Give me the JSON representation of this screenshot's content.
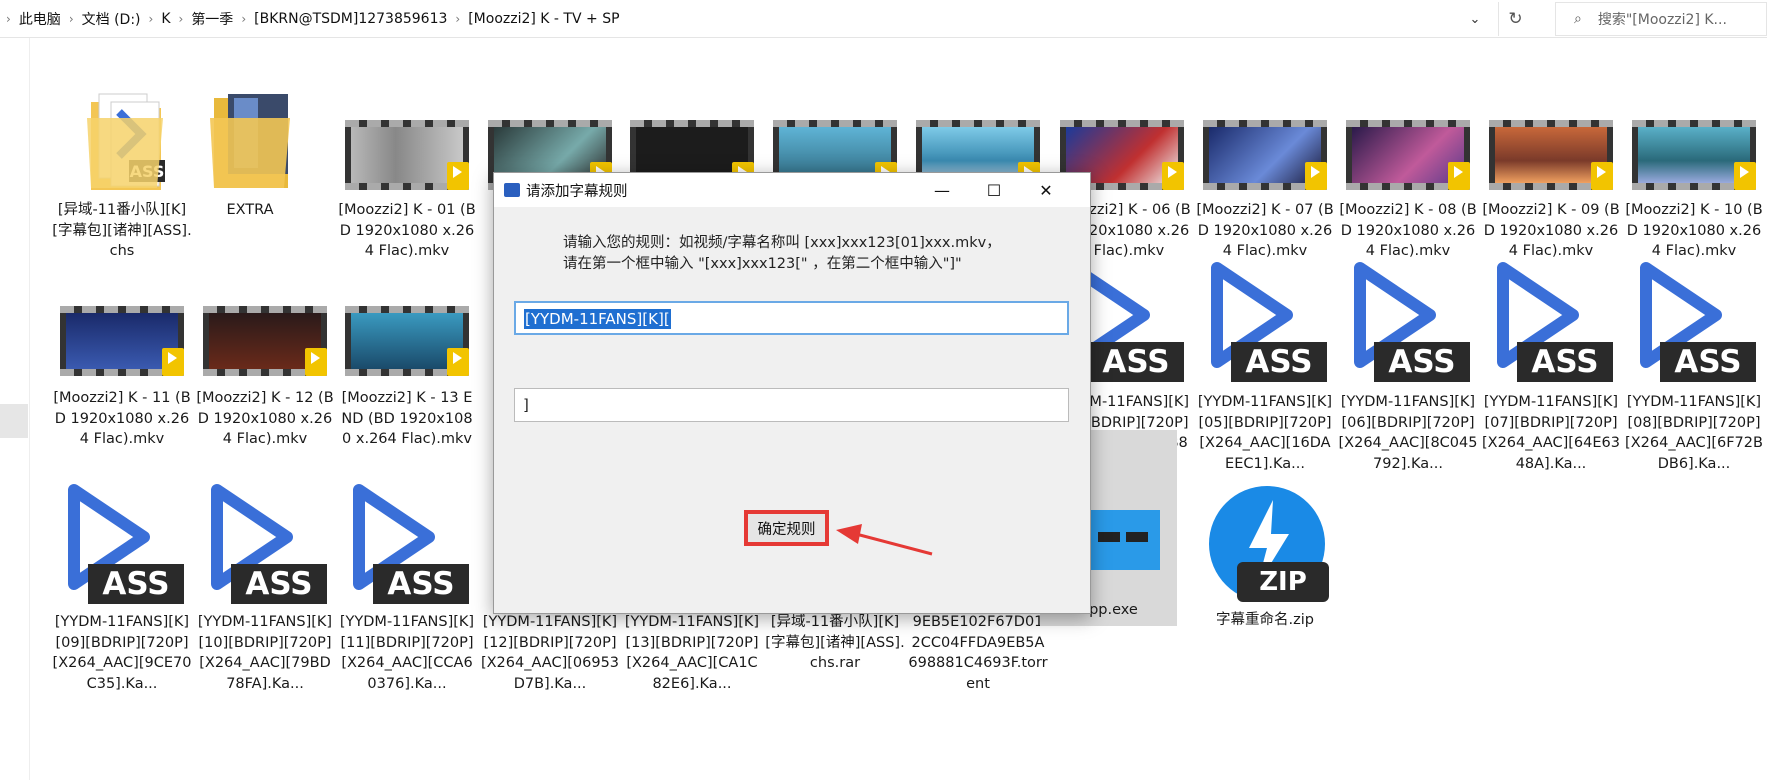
{
  "breadcrumb": [
    "此电脑",
    "文档 (D:)",
    "K",
    "第一季",
    "[BKRN@TSDM]1273859613",
    "[Moozzi2] K - TV + SP"
  ],
  "search": {
    "placeholder": "搜索\"[Moozzi2] K..."
  },
  "icons": {
    "refresh": "refresh-icon",
    "search": "search-icon",
    "dropdown": "chevron-down-icon"
  },
  "files": [
    {
      "name": "[异域-11番小队][K][字幕包][诸神][ASS].chs",
      "type": "ass-folder"
    },
    {
      "name": "EXTRA",
      "type": "folder"
    },
    {
      "name": "[Moozzi2] K - 01 (BD 1920x1080 x.264 Flac).mkv",
      "type": "video"
    },
    {
      "name": "[Moozzi2] K - 06 (BD 1920x1080 x.264 Flac).mkv",
      "type": "video"
    },
    {
      "name": "[Moozzi2] K - 07 (BD 1920x1080 x.264 Flac).mkv",
      "type": "video"
    },
    {
      "name": "[Moozzi2] K - 08 (BD 1920x1080 x.264 Flac).mkv",
      "type": "video"
    },
    {
      "name": "[Moozzi2] K - 09 (BD 1920x1080 x.264 Flac).mkv",
      "type": "video"
    },
    {
      "name": "[Moozzi2] K - 10 (BD 1920x1080 x.264 Flac).mkv",
      "type": "video"
    },
    {
      "name": "[Moozzi2] K - 11 (BD 1920x1080 x.264 Flac).mkv",
      "type": "video"
    },
    {
      "name": "[Moozzi2] K - 12 (BD 1920x1080 x.264 Flac).mkv",
      "type": "video"
    },
    {
      "name": "[Moozzi2] K - 13 END (BD 1920x1080 x.264 Flac).mkv",
      "type": "video"
    },
    {
      "name": "[YYDM-11FANS][K][04][BDRIP][720P][X264_AAC][2DB88].Ka...",
      "type": "ass"
    },
    {
      "name": "[YYDM-11FANS][K][05][BDRIP][720P][X264_AAC][16DAEEC1].Ka...",
      "type": "ass"
    },
    {
      "name": "[YYDM-11FANS][K][06][BDRIP][720P][X264_AAC][8C045792].Ka...",
      "type": "ass"
    },
    {
      "name": "[YYDM-11FANS][K][07][BDRIP][720P][X264_AAC][64E6348A].Ka...",
      "type": "ass"
    },
    {
      "name": "[YYDM-11FANS][K][08][BDRIP][720P][X264_AAC][6F72BDB6].Ka...",
      "type": "ass"
    },
    {
      "name": "[YYDM-11FANS][K][09][BDRIP][720P][X264_AAC][9CE70C35].Ka...",
      "type": "ass"
    },
    {
      "name": "[YYDM-11FANS][K][10][BDRIP][720P][X264_AAC][79BD78FA].Ka...",
      "type": "ass"
    },
    {
      "name": "[YYDM-11FANS][K][11][BDRIP][720P][X264_AAC][CCA60376].Ka...",
      "type": "ass"
    },
    {
      "name": "[YYDM-11FANS][K][12][BDRIP][720P][X264_AAC][06953D7B].Ka...",
      "type": "ass"
    },
    {
      "name": "[YYDM-11FANS][K][13][BDRIP][720P][X264_AAC][CA1C82E6].Ka...",
      "type": "ass"
    },
    {
      "name": "[异域-11番小队][K][字幕包][诸神][ASS].chs.rar",
      "type": "rar"
    },
    {
      "name": "9EB5E102F67D012CC04FFDA9EB5A698881C4693F.torrent",
      "type": "torrent"
    },
    {
      "name": "App.exe",
      "type": "exe"
    },
    {
      "name": "字幕重命名.zip",
      "type": "zip"
    }
  ],
  "badges": {
    "ass": "ASS",
    "zip": "ZIP",
    "player": "Player"
  },
  "dialog": {
    "title": "请添加字幕规则",
    "instruction_line1": "请输入您的规则：如视频/字幕名称叫 [xxx]xxx123[01]xxx.mkv，",
    "instruction_line2": "请在第一个框中输入 \"[xxx]xxx123[\" ，在第二个框中输入\"]\"",
    "field1_value": "[YYDM-11FANS][K][",
    "field2_value": "]",
    "ok_label": "确定规则",
    "minimize": "—",
    "maximize": "☐",
    "close": "✕"
  },
  "colors": {
    "accent": "#1f6fd1",
    "highlight_border": "#e53935",
    "play": "#3a6fd8",
    "player_badge": "#f2c400"
  }
}
